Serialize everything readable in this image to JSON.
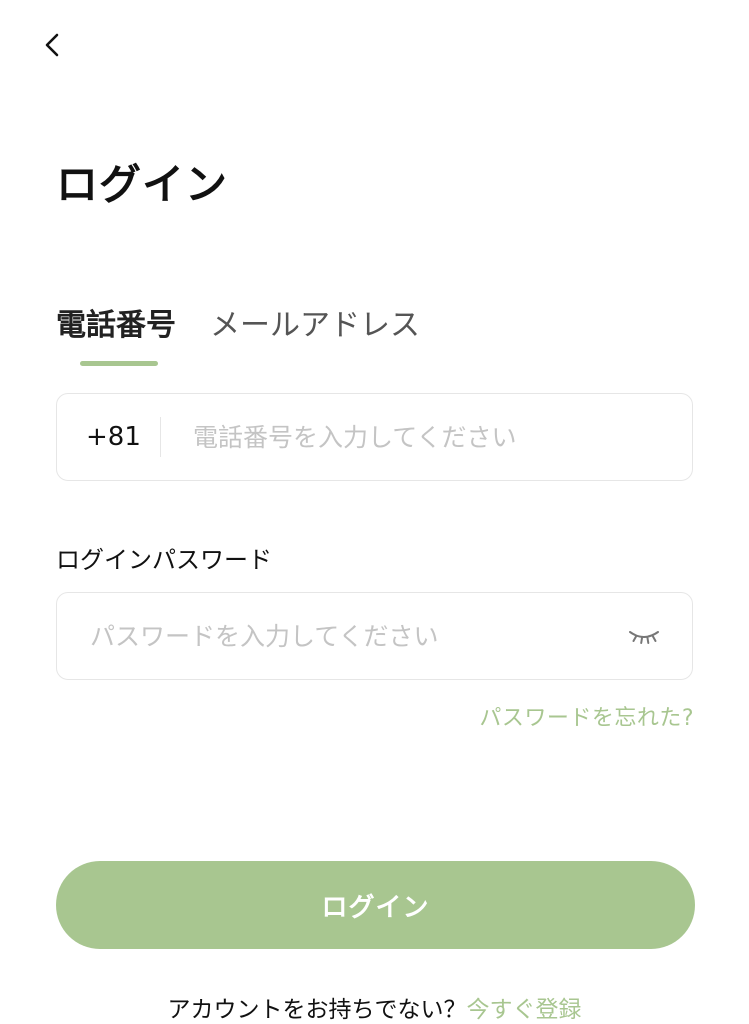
{
  "colors": {
    "accent": "#a8c690",
    "text": "#111111",
    "inactive_tab": "#555555",
    "placeholder": "#c4c4c4",
    "border": "#e6e6e6"
  },
  "header": {
    "back_icon": "chevron-left-icon"
  },
  "page": {
    "title": "ログイン"
  },
  "tabs": [
    {
      "label": "電話番号",
      "active": true
    },
    {
      "label": "メールアドレス",
      "active": false
    }
  ],
  "phone": {
    "country_code": "+81",
    "placeholder": "電話番号を入力してください",
    "value": ""
  },
  "password": {
    "label": "ログインパスワード",
    "placeholder": "パスワードを入力してください",
    "value": "",
    "toggle_icon": "eye-closed-icon"
  },
  "forgot": {
    "label": "パスワードを忘れた?"
  },
  "login_button": {
    "label": "ログイン"
  },
  "signup": {
    "prompt": "アカウントをお持ちでない？",
    "link": "今すぐ登録"
  }
}
